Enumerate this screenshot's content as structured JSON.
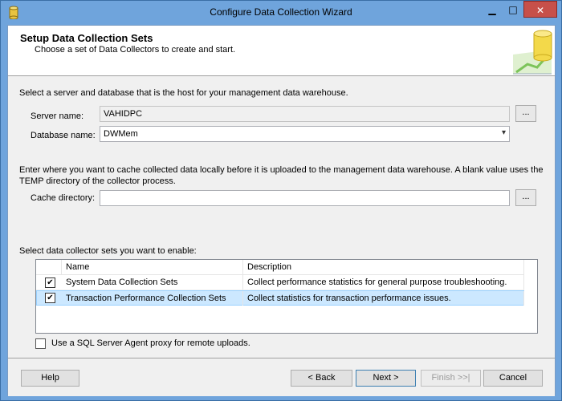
{
  "window": {
    "title": "Configure Data Collection Wizard",
    "minimize_glyph": "▁",
    "maximize_glyph": "□",
    "close_glyph": "✕"
  },
  "header": {
    "title": "Setup Data Collection Sets",
    "subtitle": "Choose a set of Data Collectors to create and start."
  },
  "server_section": {
    "instruction": "Select a server and database that is the host for your management data warehouse.",
    "server_label": "Server name:",
    "server_value": "VAHIDPC",
    "server_browse": "...",
    "database_label": "Database name:",
    "database_value": "DWMem"
  },
  "cache_section": {
    "instruction_line1": "Enter where you want to cache collected data locally before it is uploaded to the management data warehouse. A blank value uses the",
    "instruction_line2": "TEMP directory of the collector process.",
    "cache_label": "Cache directory:",
    "cache_value": "",
    "cache_browse": "..."
  },
  "collector_sets": {
    "instruction": "Select data collector sets you want to enable:",
    "columns": [
      "Name",
      "Description"
    ],
    "rows": [
      {
        "checked": true,
        "name": "System Data Collection Sets",
        "description": "Collect performance statistics for general purpose troubleshooting."
      },
      {
        "checked": true,
        "name": "Transaction Performance Collection Sets",
        "description": "Collect statistics for transaction performance issues."
      }
    ],
    "check_glyph": "✔"
  },
  "proxy_option": {
    "label": "Use a SQL Server Agent proxy for remote uploads.",
    "checked": false
  },
  "footer": {
    "help": "Help",
    "back": "< Back",
    "next": "Next >",
    "finish": "Finish >>|",
    "cancel": "Cancel"
  },
  "colors": {
    "titlebar": "#6fa4dc",
    "close_button": "#c7504a",
    "selected_row": "#cce8ff"
  },
  "icons": {
    "app": "database-cylinder-icon",
    "header_art": "database-chart-icon"
  }
}
